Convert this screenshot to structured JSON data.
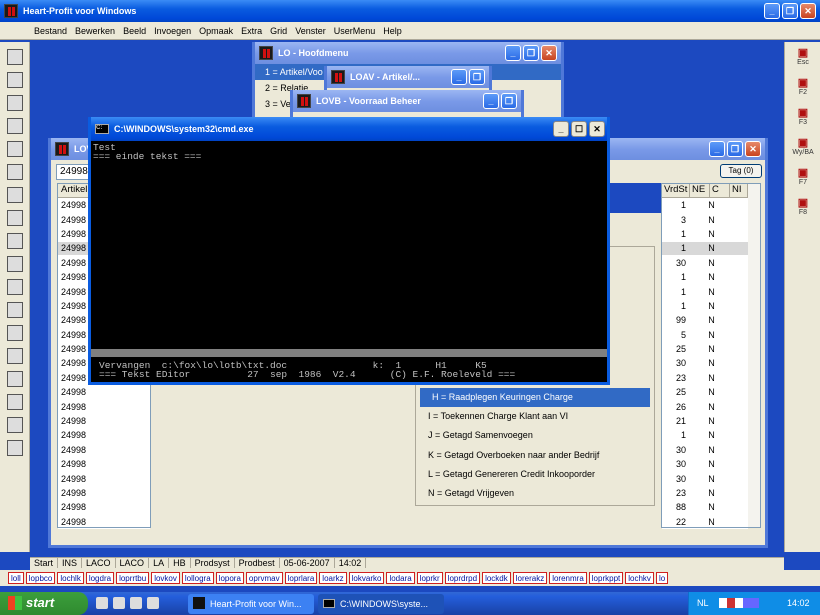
{
  "app": {
    "title": "Heart-Profit voor Windows"
  },
  "menu": [
    "Bestand",
    "Bewerken",
    "Beeld",
    "Invoegen",
    "Opmaak",
    "Extra",
    "Grid",
    "Venster",
    "UserMenu",
    "Help"
  ],
  "lo_window": {
    "title": "LO - Hoofdmenu",
    "items": [
      "1 = Artikel/Voo",
      "2 = Relatie",
      "3 = Ve"
    ]
  },
  "loav_window": {
    "title": "LOAV - Artikel/..."
  },
  "lovb_window": {
    "title": "LOVB - Voorraad Beheer"
  },
  "lov_window": {
    "title": "LOV",
    "field_value": "24998",
    "tag_button": "Tag (0)",
    "left_header": "Artikel",
    "left_rows": [
      "24998",
      "24998",
      "24998",
      "24998",
      "24998",
      "24998",
      "24998",
      "24998",
      "24998",
      "24998",
      "24998",
      "24998",
      "24998",
      "24998",
      "24998",
      "24998",
      "24998",
      "24998",
      "24998",
      "24998",
      "24998",
      "24998",
      "24998"
    ],
    "right_headers": [
      "VrdSt",
      "NE",
      "C",
      "NI"
    ],
    "right_rows": [
      [
        "1",
        "N"
      ],
      [
        "3",
        "N"
      ],
      [
        "1",
        "N"
      ],
      [
        "1",
        "N"
      ],
      [
        "30",
        "N"
      ],
      [
        "1",
        "N"
      ],
      [
        "1",
        "N"
      ],
      [
        "1",
        "N"
      ],
      [
        "99",
        "N"
      ],
      [
        "5",
        "N"
      ],
      [
        "25",
        "N"
      ],
      [
        "30",
        "N"
      ],
      [
        "23",
        "N"
      ],
      [
        "25",
        "N"
      ],
      [
        "26",
        "N"
      ],
      [
        "21",
        "N"
      ],
      [
        "1",
        "N"
      ],
      [
        "30",
        "N"
      ],
      [
        "30",
        "N"
      ],
      [
        "30",
        "N"
      ],
      [
        "23",
        "N"
      ],
      [
        "88",
        "N"
      ],
      [
        "22",
        "N"
      ]
    ],
    "options": [
      "H = Raadplegen Keuringen Charge",
      "I = Toekennen Charge Klant aan VI",
      "J = Getagd Samenvoegen",
      "K = Getagd Overboeken naar ander Bedrijf",
      "L = Getagd Genereren Credit Inkooporder",
      "N = Getagd Vrijgeven"
    ]
  },
  "cmd_window": {
    "title": "C:\\WINDOWS\\system32\\cmd.exe",
    "lines": [
      "Test",
      "=== einde tekst ==="
    ],
    "status1": "Vervangen  c:\\fox\\lo\\lotb\\txt.doc               k:  1      H1     K5",
    "status2": "=== Tekst EDitor          27  sep  1986  V2.4      (C) E.F. Roeleveld ==="
  },
  "statusbar": [
    "Start",
    "INS",
    "LACO",
    "LACO",
    "LA",
    "HB",
    "Prodsyst",
    "Prodbest",
    "05-06-2007",
    "14:02"
  ],
  "quicktasks": [
    "loll",
    "lopbco",
    "lochlk",
    "logdra",
    "loprrtbu",
    "lovkov",
    "lollogra",
    "lopora",
    "oprvmav",
    "loprlara",
    "loarkz",
    "lokvarko",
    "lodara",
    "loprkr",
    "loprdrpd",
    "lockdk",
    "lorerakz",
    "lorenmra",
    "loprkppt",
    "lochkv",
    "lo"
  ],
  "taskbar": {
    "start": "start",
    "buttons": [
      "Heart-Profit voor Win...",
      "C:\\WINDOWS\\syste..."
    ],
    "lang": "NL",
    "time": "14:02"
  },
  "right_toolbar": [
    {
      "icon": "exit-icon",
      "label": "Esc"
    },
    {
      "icon": "f2-icon",
      "label": "F2"
    },
    {
      "icon": "f3-icon",
      "label": "F3"
    },
    {
      "icon": "wyba-icon",
      "label": "Wy/BA"
    },
    {
      "icon": "f7-icon",
      "label": "F7"
    },
    {
      "icon": "f8-icon",
      "label": "F8"
    }
  ]
}
